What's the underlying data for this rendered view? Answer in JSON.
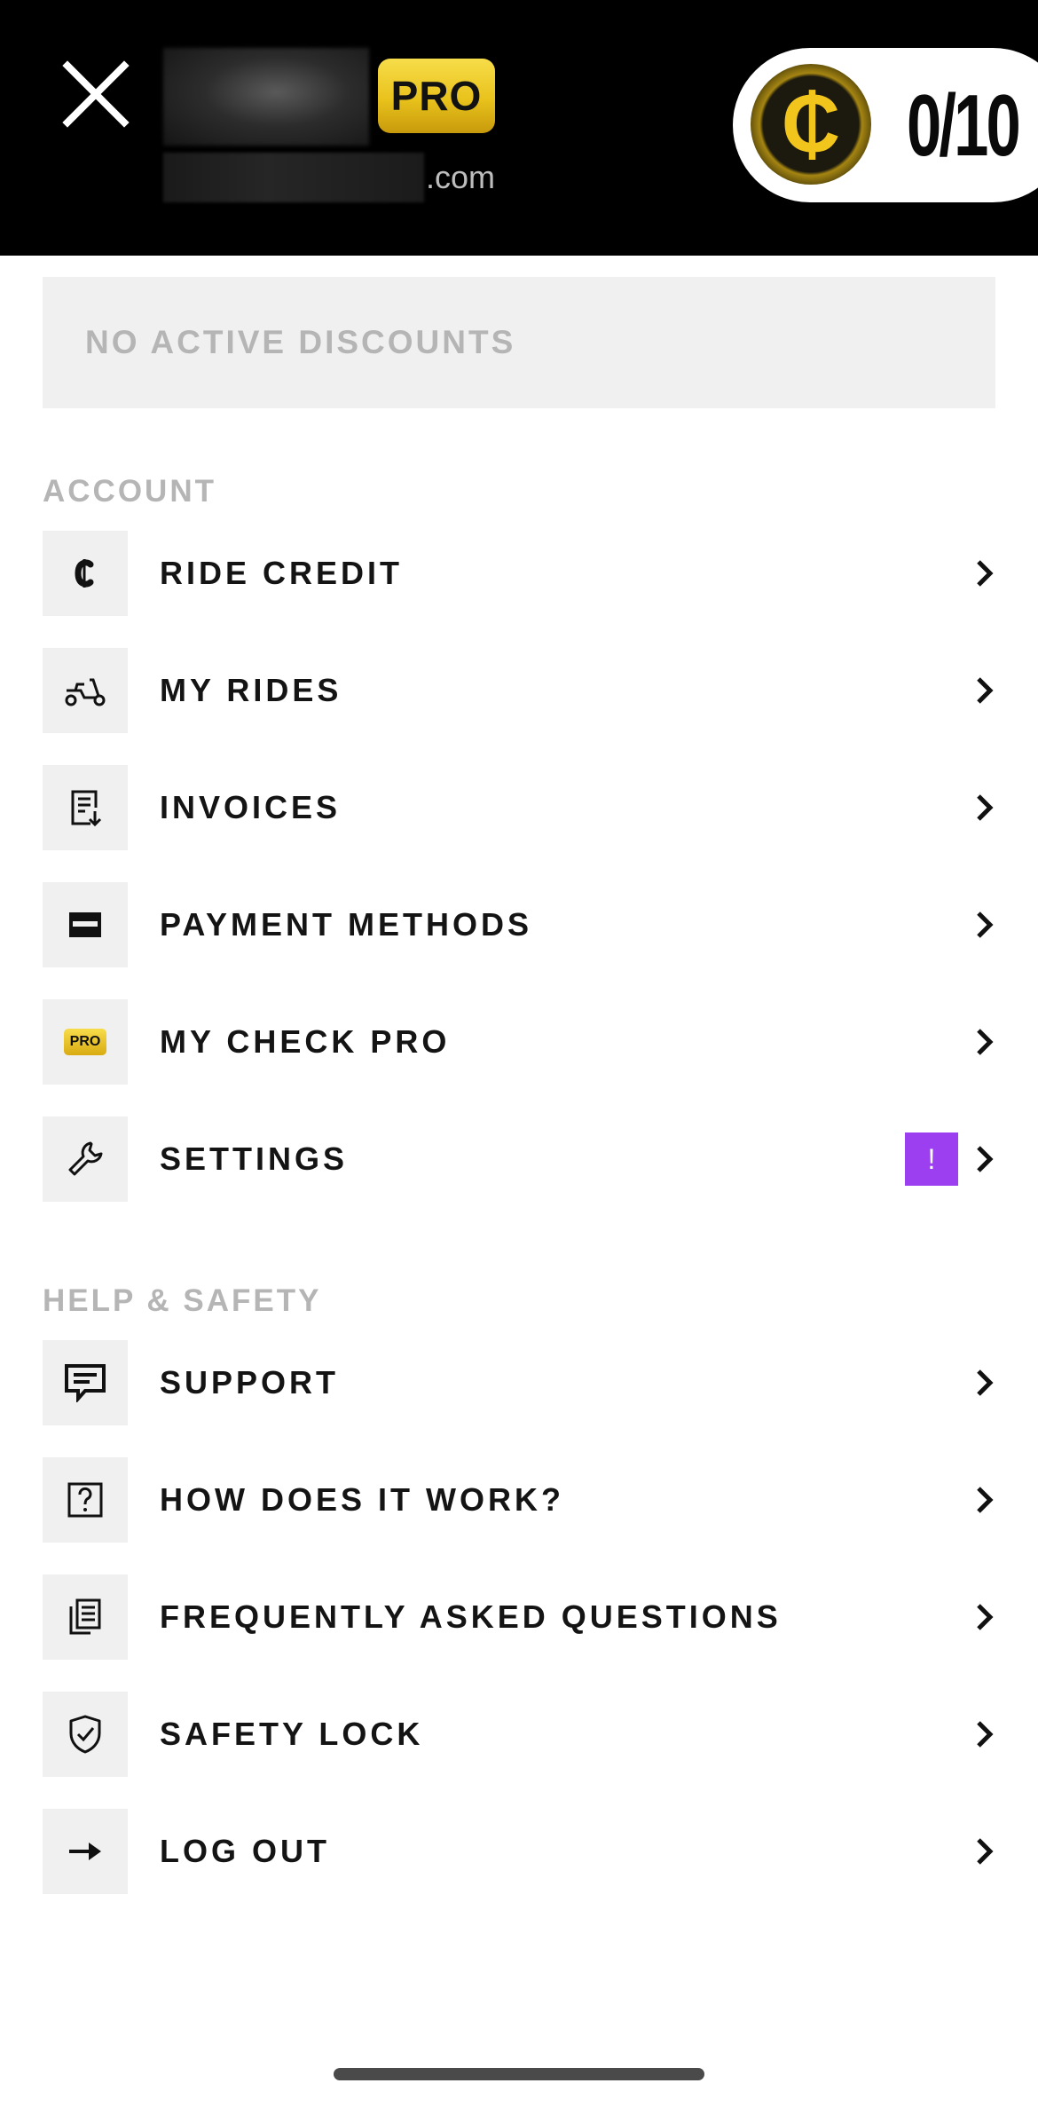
{
  "header": {
    "email_suffix": ".com",
    "pro_badge": "PRO",
    "credit_coin_symbol": "₵",
    "credit_count": "0/10"
  },
  "discounts": {
    "text": "NO ACTIVE DISCOUNTS"
  },
  "account": {
    "title": "ACCOUNT",
    "items": [
      {
        "label": "RIDE CREDIT",
        "icon": "credit-coin-icon"
      },
      {
        "label": "MY RIDES",
        "icon": "scooter-icon"
      },
      {
        "label": "INVOICES",
        "icon": "invoice-download-icon"
      },
      {
        "label": "PAYMENT METHODS",
        "icon": "card-icon"
      },
      {
        "label": "MY CHECK PRO",
        "icon": "pro-badge-icon",
        "icon_text": "PRO"
      },
      {
        "label": "SETTINGS",
        "icon": "wrench-icon",
        "alert": "!"
      }
    ]
  },
  "help": {
    "title": "HELP & SAFETY",
    "items": [
      {
        "label": "SUPPORT",
        "icon": "chat-icon"
      },
      {
        "label": "HOW DOES IT WORK?",
        "icon": "question-icon"
      },
      {
        "label": "FREQUENTLY ASKED QUESTIONS",
        "icon": "documents-icon"
      },
      {
        "label": "SAFETY LOCK",
        "icon": "shield-check-icon"
      },
      {
        "label": "LOG OUT",
        "icon": "arrow-right-icon"
      }
    ]
  },
  "colors": {
    "header_bg": "#000000",
    "pro_gold": "#e9c21c",
    "alert_purple": "#9b3ff0",
    "muted_text": "#b5b5b5",
    "icon_box_bg": "#f0f0f0"
  }
}
